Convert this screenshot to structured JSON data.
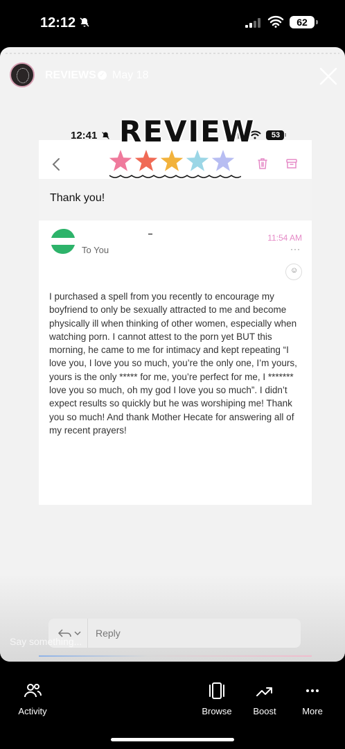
{
  "status_bar": {
    "time": "12:12",
    "battery": "62"
  },
  "story": {
    "account": "REVIEWS",
    "date": "May 18"
  },
  "inner_screenshot": {
    "time": "12:41",
    "battery": "53",
    "sticker_title": "REVIEW"
  },
  "email": {
    "subject": "Thank you!",
    "to": "To You",
    "time": "11:54 AM",
    "more": "···",
    "body": "I purchased a spell from you recently to encourage my boyfriend to only be sexually attracted to me and become physically ill when thinking of other women, especially when watching porn. I cannot attest to the porn yet BUT this morning, he came to me for intimacy and kept repeating “I love you, I love you so much, you’re the only one, I’m yours, yours is the only ***** for me, you’re perfect for me, I ******* love you so much, oh my god I love you so much”. I didn’t expect results so quickly but he was worshiping me! Thank you so much! And thank Mother Hecate for answering all of my recent prayers!",
    "reply_label": "Reply"
  },
  "reply_placeholder": "Say something...",
  "nav": {
    "activity": "Activity",
    "browse": "Browse",
    "boost": "Boost",
    "more": "More"
  },
  "star_colors": [
    "#ef7a9c",
    "#f06a55",
    "#f2b23c",
    "#9bd6e6",
    "#b7bdf2"
  ],
  "icons": [
    "mute-icon",
    "signal-icon",
    "wifi-icon",
    "close-icon",
    "back-icon",
    "trash-icon",
    "archive-icon",
    "reply-icon",
    "activity-icon",
    "browse-icon",
    "boost-icon",
    "more-icon"
  ]
}
